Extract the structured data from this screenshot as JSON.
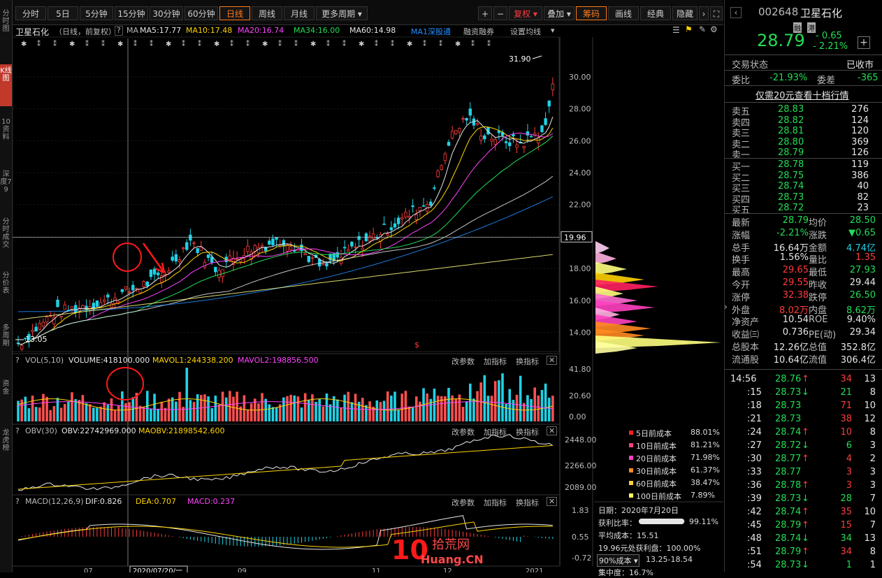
{
  "rail": [
    {
      "label": "分时图",
      "active": false
    },
    {
      "label": "K线图",
      "active": true
    },
    {
      "label": "10资料",
      "active": false
    },
    {
      "label": "深度79",
      "active": false
    },
    {
      "label": "分时成交",
      "active": false
    },
    {
      "label": "分价表",
      "active": false
    },
    {
      "label": "多周期",
      "active": false
    },
    {
      "label": "资金",
      "active": false
    },
    {
      "label": "龙虎榜",
      "active": false
    }
  ],
  "toolbar": {
    "periods": [
      "分时",
      "5日",
      "5分钟",
      "15分钟",
      "30分钟",
      "60分钟",
      "日线",
      "周线",
      "月线",
      "更多周期"
    ],
    "active_period": "日线",
    "tools": [
      "+",
      "−"
    ],
    "fuquan": "复权",
    "overlay": "叠加",
    "chouma": "筹码",
    "draw": "画线",
    "classic": "经典",
    "hide": "隐藏"
  },
  "kheader": {
    "stock": "卫星石化",
    "mode": "（日线，前复权）",
    "ma_label": "MA",
    "ma5": "MA5:17.77",
    "ma10": "MA10:17.48",
    "ma20": "MA20:16.74",
    "ma34": "MA34:16.00",
    "ma60": "MA60:14.98",
    "ma1": "MA1深股通",
    "rzrq": "融资融券",
    "setma": "设置均线"
  },
  "price_axis": [
    "30.00",
    "28.00",
    "26.00",
    "24.00",
    "22.00",
    "20.00",
    "18.00",
    "16.00",
    "14.00"
  ],
  "price_marks": {
    "high": "31.90",
    "low": "13.05",
    "cursor": "19.96"
  },
  "vol_pane": {
    "title": "VOL(5,10)",
    "volume": "VOLUME:418100.000",
    "mavol1": "MAVOL1:244338.200",
    "mavol2": "MAVOL2:198856.500",
    "axis": [
      "41.80",
      "20.60",
      "0.00"
    ],
    "actions": [
      "改参数",
      "加指标",
      "换指标"
    ]
  },
  "obv_pane": {
    "title": "OBV(30)",
    "obv": "OBV:22742969.000",
    "maobv": "MAOBV:21898542.600",
    "axis": [
      "2448.00",
      "2266.00",
      "2089.00"
    ],
    "actions": [
      "改参数",
      "加指标",
      "换指标"
    ]
  },
  "macd_pane": {
    "title": "MACD(12,26,9)",
    "dif": "DIF:0.826",
    "dea": "DEA:0.707",
    "macd": "MACD:0.237",
    "axis": [
      "1.83",
      "0.55",
      "-0.72"
    ],
    "actions": [
      "改参数",
      "加指标",
      "换指标"
    ]
  },
  "xaxis": [
    "07",
    "2020/07/20/一",
    "09",
    "11",
    "12",
    "2021"
  ],
  "chip_legend": [
    {
      "label": "5日前成本",
      "value": "88.01%",
      "color": "#ff2020"
    },
    {
      "label": "10日前成本",
      "value": "81.21%",
      "color": "#ff4080"
    },
    {
      "label": "20日前成本",
      "value": "71.98%",
      "color": "#ff40c0"
    },
    {
      "label": "30日前成本",
      "value": "61.37%",
      "color": "#ff8a20"
    },
    {
      "label": "60日前成本",
      "value": "38.47%",
      "color": "#ffd040"
    },
    {
      "label": "100日前成本",
      "value": "7.89%",
      "color": "#ffff60"
    }
  ],
  "chip_info": {
    "date": "日期：2020年7月20日",
    "profit_label": "获利比率：",
    "profit_value": "99.11%",
    "profit_ratio": 0.9911,
    "avg": "平均成本：15.51",
    "price_profit": "19.96元处获利盘：100.00%",
    "range_select": "90%成本",
    "range": "13.25-18.54",
    "concentration": "集中度：16.7%"
  },
  "quote": {
    "code": "002648",
    "name": "卫星石化",
    "tags": [
      "融",
      "港"
    ],
    "price": "28.79",
    "change": "- 0.65",
    "change_pct": "- 2.21%",
    "status_label": "交易状态",
    "status": "已收市",
    "weibi_label": "委比",
    "weibi": "-21.93%",
    "weicha_label": "委差",
    "weicha": "-365",
    "tenlevel": "仅需20元查看十档行情"
  },
  "asks": [
    {
      "label": "卖五",
      "price": "28.83",
      "vol": "276"
    },
    {
      "label": "卖四",
      "price": "28.82",
      "vol": "124"
    },
    {
      "label": "卖三",
      "price": "28.81",
      "vol": "120"
    },
    {
      "label": "卖二",
      "price": "28.80",
      "vol": "369"
    },
    {
      "label": "卖一",
      "price": "28.79",
      "vol": "126"
    }
  ],
  "bids": [
    {
      "label": "买一",
      "price": "28.78",
      "vol": "119"
    },
    {
      "label": "买二",
      "price": "28.75",
      "vol": "386"
    },
    {
      "label": "买三",
      "price": "28.74",
      "vol": "40"
    },
    {
      "label": "买四",
      "price": "28.73",
      "vol": "82"
    },
    {
      "label": "买五",
      "price": "28.72",
      "vol": "23"
    }
  ],
  "stats": [
    {
      "l1": "最新",
      "v1": "28.79",
      "c1": "green",
      "l2": "均价",
      "v2": "28.50",
      "c2": "green"
    },
    {
      "l1": "涨幅",
      "v1": "-2.21%",
      "c1": "green",
      "l2": "涨跌",
      "v2": "▼0.65",
      "c2": "green"
    },
    {
      "l1": "总手",
      "v1": "16.64万",
      "c1": "white",
      "l2": "金额",
      "v2": "4.74亿",
      "c2": "cyan"
    },
    {
      "l1": "换手",
      "v1": "1.56%",
      "c1": "white",
      "l2": "量比",
      "v2": "1.35",
      "c2": "red"
    },
    {
      "l1": "最高",
      "v1": "29.65",
      "c1": "red",
      "l2": "最低",
      "v2": "27.93",
      "c2": "green"
    },
    {
      "l1": "今开",
      "v1": "29.55",
      "c1": "red",
      "l2": "昨收",
      "v2": "29.44",
      "c2": "white"
    },
    {
      "l1": "涨停",
      "v1": "32.38",
      "c1": "red",
      "l2": "跌停",
      "v2": "26.50",
      "c2": "green"
    },
    {
      "l1": "外盘",
      "v1": "8.02万",
      "c1": "red",
      "l2": "内盘",
      "v2": "8.62万",
      "c2": "green"
    },
    {
      "l1": "净资产",
      "v1": "10.54",
      "c1": "white",
      "l2": "ROE",
      "v2": "9.40%",
      "c2": "white"
    },
    {
      "l1": "收益㈢",
      "v1": "0.736",
      "c1": "white",
      "l2": "PE(动)",
      "v2": "29.34",
      "c2": "white"
    },
    {
      "l1": "总股本",
      "v1": "12.26亿",
      "c1": "white",
      "l2": "总值",
      "v2": "352.8亿",
      "c2": "white"
    },
    {
      "l1": "流通股",
      "v1": "10.64亿",
      "c1": "white",
      "l2": "流值",
      "v2": "306.4亿",
      "c2": "white"
    }
  ],
  "ticks": [
    {
      "t": "14:56",
      "p": "28.76",
      "d": "up",
      "v": "34",
      "n": "13"
    },
    {
      "t": ":15",
      "p": "28.73",
      "d": "down",
      "v": "21",
      "n": "8"
    },
    {
      "t": ":18",
      "p": "28.73",
      "d": "",
      "v": "71",
      "n": "10"
    },
    {
      "t": ":21",
      "p": "28.73",
      "d": "",
      "v": "38",
      "n": "12"
    },
    {
      "t": ":24",
      "p": "28.74",
      "d": "up",
      "v": "10",
      "n": "8"
    },
    {
      "t": ":27",
      "p": "28.72",
      "d": "down",
      "v": "6",
      "n": "3"
    },
    {
      "t": ":30",
      "p": "28.77",
      "d": "up",
      "v": "4",
      "n": "2"
    },
    {
      "t": ":33",
      "p": "28.77",
      "d": "",
      "v": "3",
      "n": "3"
    },
    {
      "t": ":36",
      "p": "28.78",
      "d": "up",
      "v": "3",
      "n": "3"
    },
    {
      "t": ":39",
      "p": "28.73",
      "d": "down",
      "v": "28",
      "n": "7"
    },
    {
      "t": ":42",
      "p": "28.74",
      "d": "up",
      "v": "35",
      "n": "10"
    },
    {
      "t": ":45",
      "p": "28.79",
      "d": "up",
      "v": "15",
      "n": "7"
    },
    {
      "t": ":48",
      "p": "28.74",
      "d": "down",
      "v": "34",
      "n": "13"
    },
    {
      "t": ":51",
      "p": "28.79",
      "d": "up",
      "v": "34",
      "n": "8"
    },
    {
      "t": ":54",
      "p": "28.73",
      "d": "down",
      "v": "1",
      "n": "1"
    }
  ],
  "watermark": {
    "num": "10",
    "cn": "拾荒网",
    "en": "Huang.CN"
  }
}
